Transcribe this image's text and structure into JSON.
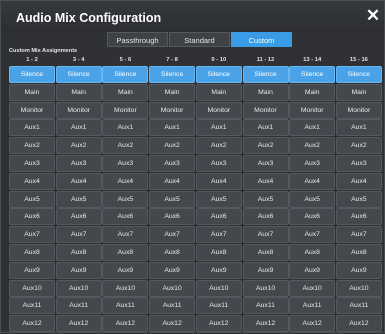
{
  "window": {
    "title": "Audio Mix Configuration",
    "close_glyph": "✕"
  },
  "modes": {
    "options": [
      "Passthrough",
      "Standard",
      "Custom"
    ],
    "selected": "Custom"
  },
  "section": {
    "label": "Custom Mix Assignments"
  },
  "columns": [
    "1 - 2",
    "3 - 4",
    "5 - 6",
    "7 - 8",
    "9 - 10",
    "11 - 12",
    "13 - 14",
    "15 - 16"
  ],
  "rows": [
    "Silence",
    "Main",
    "Monitor",
    "Aux1",
    "Aux2",
    "Aux3",
    "Aux4",
    "Aux5",
    "Aux6",
    "Aux7",
    "Aux8",
    "Aux9",
    "Aux10",
    "Aux11",
    "Aux12"
  ],
  "selected_row": "Silence",
  "colors": {
    "accent": "#3a9be6",
    "cell": "#44474c",
    "background": "#2f3134"
  }
}
